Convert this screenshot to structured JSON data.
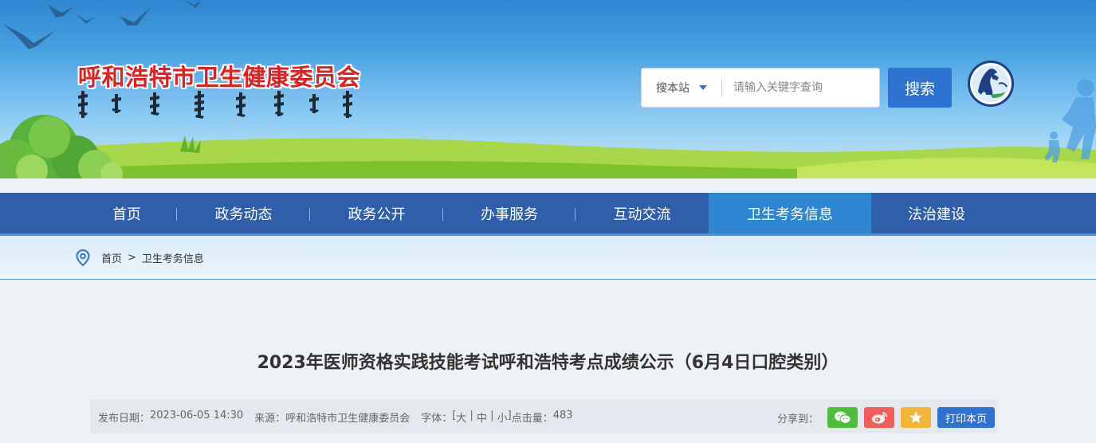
{
  "header": {
    "site_title": "呼和浩特市卫生健康委员会",
    "search": {
      "scope_label": "搜本站",
      "placeholder": "请输入关键字查询",
      "button_label": "搜索"
    }
  },
  "nav": {
    "items": [
      {
        "label": "首页"
      },
      {
        "label": "政务动态"
      },
      {
        "label": "政务公开"
      },
      {
        "label": "办事服务"
      },
      {
        "label": "互动交流"
      },
      {
        "label": "卫生考务信息",
        "active": true
      },
      {
        "label": "法治建设"
      }
    ]
  },
  "breadcrumb": {
    "home": "首页",
    "separator": ">",
    "current": "卫生考务信息"
  },
  "article": {
    "title": "2023年医师资格实践技能考试呼和浩特考点成绩公示（6月4日口腔类别）",
    "meta": {
      "date_label": "发布日期：",
      "date": "2023-06-05 14:30",
      "source_label": "来源：",
      "source": "呼和浩特市卫生健康委员会",
      "font_label": "字体：",
      "font_open": "[",
      "font_large": "大",
      "font_sep": " | ",
      "font_medium": "中",
      "font_small": "小",
      "font_close": "]",
      "views_label": "点击量：",
      "views": "483"
    },
    "share": {
      "label": "分享到：",
      "wechat_icon": "wechat-icon",
      "weibo_icon": "weibo-icon",
      "favorite_icon": "star-icon",
      "print_label": "打印本页"
    }
  },
  "colors": {
    "nav_bg": "#2f5fa8",
    "nav_active": "#2e86d2",
    "title_red": "#e02020",
    "accent_blue": "#2f73d2"
  }
}
